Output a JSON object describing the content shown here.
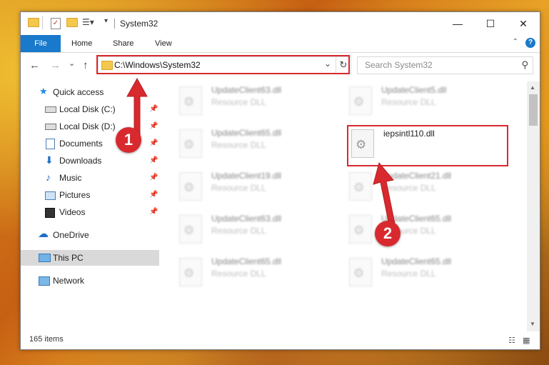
{
  "window": {
    "title": "System32",
    "controls": {
      "minimize": "—",
      "maximize": "☐",
      "close": "✕"
    }
  },
  "ribbon": {
    "tabs": [
      "File",
      "Home",
      "Share",
      "View"
    ],
    "help": "?",
    "collapse": "⌃"
  },
  "navigation": {
    "back": "←",
    "forward": "→",
    "recent": "⌄",
    "up": "↑",
    "address": "C:\\Windows\\System32",
    "dropdown": "⌄",
    "refresh": "↻",
    "search_placeholder": "Search System32",
    "search_icon": "⚲"
  },
  "sidebar": {
    "items": [
      {
        "label": "Quick access",
        "icon": "star-icon",
        "pinned": false
      },
      {
        "label": "Local Disk (C:)",
        "icon": "drive-icon",
        "pinned": true
      },
      {
        "label": "Local Disk (D:)",
        "icon": "drive-icon",
        "pinned": true
      },
      {
        "label": "Documents",
        "icon": "documents-icon",
        "pinned": true
      },
      {
        "label": "Downloads",
        "icon": "download-icon",
        "pinned": true
      },
      {
        "label": "Music",
        "icon": "music-icon",
        "pinned": true
      },
      {
        "label": "Pictures",
        "icon": "pictures-icon",
        "pinned": true
      },
      {
        "label": "Videos",
        "icon": "videos-icon",
        "pinned": true
      },
      {
        "label": "OneDrive",
        "icon": "cloud-icon",
        "pinned": false
      },
      {
        "label": "This PC",
        "icon": "computer-icon",
        "pinned": false,
        "selected": true
      },
      {
        "label": "Network",
        "icon": "network-icon",
        "pinned": false
      }
    ]
  },
  "files": [
    {
      "name": "UpdateClient63.dll",
      "type": "Resource DLL",
      "blurred": true
    },
    {
      "name": "UpdateClient5.dll",
      "type": "Resource DLL",
      "blurred": true
    },
    {
      "name": "UpdateClient65.dll",
      "type": "Resource DLL",
      "blurred": true
    },
    {
      "name": "iepsintl110.dll",
      "type": "",
      "blurred": false
    },
    {
      "name": "UpdateClient19.dll",
      "type": "Resource DLL",
      "blurred": true
    },
    {
      "name": "UpdateClient21.dll",
      "type": "Resource DLL",
      "blurred": true
    },
    {
      "name": "UpdateClient63.dll",
      "type": "Resource DLL",
      "blurred": true
    },
    {
      "name": "UpdateClient65.dll",
      "type": "Resource DLL",
      "blurred": true
    },
    {
      "name": "UpdateClient65.dll",
      "type": "Resource DLL",
      "blurred": true
    },
    {
      "name": "UpdateClient65.dll",
      "type": "Resource DLL",
      "blurred": true
    }
  ],
  "status": {
    "item_count": "165 items"
  },
  "annotations": {
    "badges": [
      "1",
      "2"
    ],
    "color": "#d8292f"
  },
  "colors": {
    "accent": "#1979ca",
    "selection": "#d9d9d9",
    "highlight": "#d8292f"
  }
}
